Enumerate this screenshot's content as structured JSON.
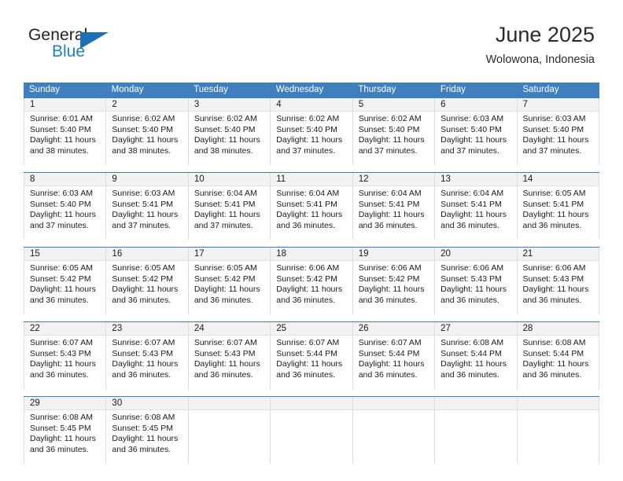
{
  "brand": {
    "name_top": "General",
    "name_bottom": "Blue",
    "accent_color": "#1f7fc4",
    "triangle_color": "#1f6fb5"
  },
  "header": {
    "title": "June 2025",
    "subtitle": "Wolowona, Indonesia"
  },
  "calendar": {
    "header_color": "#3f7fbf",
    "day_band_color": "#f2f2f2",
    "weekdays": [
      "Sunday",
      "Monday",
      "Tuesday",
      "Wednesday",
      "Thursday",
      "Friday",
      "Saturday"
    ],
    "weeks": [
      {
        "days": [
          {
            "date": "1",
            "sunrise": "Sunrise: 6:01 AM",
            "sunset": "Sunset: 5:40 PM",
            "daylight_1": "Daylight: 11 hours",
            "daylight_2": "and 38 minutes."
          },
          {
            "date": "2",
            "sunrise": "Sunrise: 6:02 AM",
            "sunset": "Sunset: 5:40 PM",
            "daylight_1": "Daylight: 11 hours",
            "daylight_2": "and 38 minutes."
          },
          {
            "date": "3",
            "sunrise": "Sunrise: 6:02 AM",
            "sunset": "Sunset: 5:40 PM",
            "daylight_1": "Daylight: 11 hours",
            "daylight_2": "and 38 minutes."
          },
          {
            "date": "4",
            "sunrise": "Sunrise: 6:02 AM",
            "sunset": "Sunset: 5:40 PM",
            "daylight_1": "Daylight: 11 hours",
            "daylight_2": "and 37 minutes."
          },
          {
            "date": "5",
            "sunrise": "Sunrise: 6:02 AM",
            "sunset": "Sunset: 5:40 PM",
            "daylight_1": "Daylight: 11 hours",
            "daylight_2": "and 37 minutes."
          },
          {
            "date": "6",
            "sunrise": "Sunrise: 6:03 AM",
            "sunset": "Sunset: 5:40 PM",
            "daylight_1": "Daylight: 11 hours",
            "daylight_2": "and 37 minutes."
          },
          {
            "date": "7",
            "sunrise": "Sunrise: 6:03 AM",
            "sunset": "Sunset: 5:40 PM",
            "daylight_1": "Daylight: 11 hours",
            "daylight_2": "and 37 minutes."
          }
        ]
      },
      {
        "days": [
          {
            "date": "8",
            "sunrise": "Sunrise: 6:03 AM",
            "sunset": "Sunset: 5:40 PM",
            "daylight_1": "Daylight: 11 hours",
            "daylight_2": "and 37 minutes."
          },
          {
            "date": "9",
            "sunrise": "Sunrise: 6:03 AM",
            "sunset": "Sunset: 5:41 PM",
            "daylight_1": "Daylight: 11 hours",
            "daylight_2": "and 37 minutes."
          },
          {
            "date": "10",
            "sunrise": "Sunrise: 6:04 AM",
            "sunset": "Sunset: 5:41 PM",
            "daylight_1": "Daylight: 11 hours",
            "daylight_2": "and 37 minutes."
          },
          {
            "date": "11",
            "sunrise": "Sunrise: 6:04 AM",
            "sunset": "Sunset: 5:41 PM",
            "daylight_1": "Daylight: 11 hours",
            "daylight_2": "and 36 minutes."
          },
          {
            "date": "12",
            "sunrise": "Sunrise: 6:04 AM",
            "sunset": "Sunset: 5:41 PM",
            "daylight_1": "Daylight: 11 hours",
            "daylight_2": "and 36 minutes."
          },
          {
            "date": "13",
            "sunrise": "Sunrise: 6:04 AM",
            "sunset": "Sunset: 5:41 PM",
            "daylight_1": "Daylight: 11 hours",
            "daylight_2": "and 36 minutes."
          },
          {
            "date": "14",
            "sunrise": "Sunrise: 6:05 AM",
            "sunset": "Sunset: 5:41 PM",
            "daylight_1": "Daylight: 11 hours",
            "daylight_2": "and 36 minutes."
          }
        ]
      },
      {
        "days": [
          {
            "date": "15",
            "sunrise": "Sunrise: 6:05 AM",
            "sunset": "Sunset: 5:42 PM",
            "daylight_1": "Daylight: 11 hours",
            "daylight_2": "and 36 minutes."
          },
          {
            "date": "16",
            "sunrise": "Sunrise: 6:05 AM",
            "sunset": "Sunset: 5:42 PM",
            "daylight_1": "Daylight: 11 hours",
            "daylight_2": "and 36 minutes."
          },
          {
            "date": "17",
            "sunrise": "Sunrise: 6:05 AM",
            "sunset": "Sunset: 5:42 PM",
            "daylight_1": "Daylight: 11 hours",
            "daylight_2": "and 36 minutes."
          },
          {
            "date": "18",
            "sunrise": "Sunrise: 6:06 AM",
            "sunset": "Sunset: 5:42 PM",
            "daylight_1": "Daylight: 11 hours",
            "daylight_2": "and 36 minutes."
          },
          {
            "date": "19",
            "sunrise": "Sunrise: 6:06 AM",
            "sunset": "Sunset: 5:42 PM",
            "daylight_1": "Daylight: 11 hours",
            "daylight_2": "and 36 minutes."
          },
          {
            "date": "20",
            "sunrise": "Sunrise: 6:06 AM",
            "sunset": "Sunset: 5:43 PM",
            "daylight_1": "Daylight: 11 hours",
            "daylight_2": "and 36 minutes."
          },
          {
            "date": "21",
            "sunrise": "Sunrise: 6:06 AM",
            "sunset": "Sunset: 5:43 PM",
            "daylight_1": "Daylight: 11 hours",
            "daylight_2": "and 36 minutes."
          }
        ]
      },
      {
        "days": [
          {
            "date": "22",
            "sunrise": "Sunrise: 6:07 AM",
            "sunset": "Sunset: 5:43 PM",
            "daylight_1": "Daylight: 11 hours",
            "daylight_2": "and 36 minutes."
          },
          {
            "date": "23",
            "sunrise": "Sunrise: 6:07 AM",
            "sunset": "Sunset: 5:43 PM",
            "daylight_1": "Daylight: 11 hours",
            "daylight_2": "and 36 minutes."
          },
          {
            "date": "24",
            "sunrise": "Sunrise: 6:07 AM",
            "sunset": "Sunset: 5:43 PM",
            "daylight_1": "Daylight: 11 hours",
            "daylight_2": "and 36 minutes."
          },
          {
            "date": "25",
            "sunrise": "Sunrise: 6:07 AM",
            "sunset": "Sunset: 5:44 PM",
            "daylight_1": "Daylight: 11 hours",
            "daylight_2": "and 36 minutes."
          },
          {
            "date": "26",
            "sunrise": "Sunrise: 6:07 AM",
            "sunset": "Sunset: 5:44 PM",
            "daylight_1": "Daylight: 11 hours",
            "daylight_2": "and 36 minutes."
          },
          {
            "date": "27",
            "sunrise": "Sunrise: 6:08 AM",
            "sunset": "Sunset: 5:44 PM",
            "daylight_1": "Daylight: 11 hours",
            "daylight_2": "and 36 minutes."
          },
          {
            "date": "28",
            "sunrise": "Sunrise: 6:08 AM",
            "sunset": "Sunset: 5:44 PM",
            "daylight_1": "Daylight: 11 hours",
            "daylight_2": "and 36 minutes."
          }
        ]
      },
      {
        "days": [
          {
            "date": "29",
            "sunrise": "Sunrise: 6:08 AM",
            "sunset": "Sunset: 5:45 PM",
            "daylight_1": "Daylight: 11 hours",
            "daylight_2": "and 36 minutes."
          },
          {
            "date": "30",
            "sunrise": "Sunrise: 6:08 AM",
            "sunset": "Sunset: 5:45 PM",
            "daylight_1": "Daylight: 11 hours",
            "daylight_2": "and 36 minutes."
          },
          {
            "date": "",
            "sunrise": "",
            "sunset": "",
            "daylight_1": "",
            "daylight_2": ""
          },
          {
            "date": "",
            "sunrise": "",
            "sunset": "",
            "daylight_1": "",
            "daylight_2": ""
          },
          {
            "date": "",
            "sunrise": "",
            "sunset": "",
            "daylight_1": "",
            "daylight_2": ""
          },
          {
            "date": "",
            "sunrise": "",
            "sunset": "",
            "daylight_1": "",
            "daylight_2": ""
          },
          {
            "date": "",
            "sunrise": "",
            "sunset": "",
            "daylight_1": "",
            "daylight_2": ""
          }
        ]
      }
    ]
  }
}
